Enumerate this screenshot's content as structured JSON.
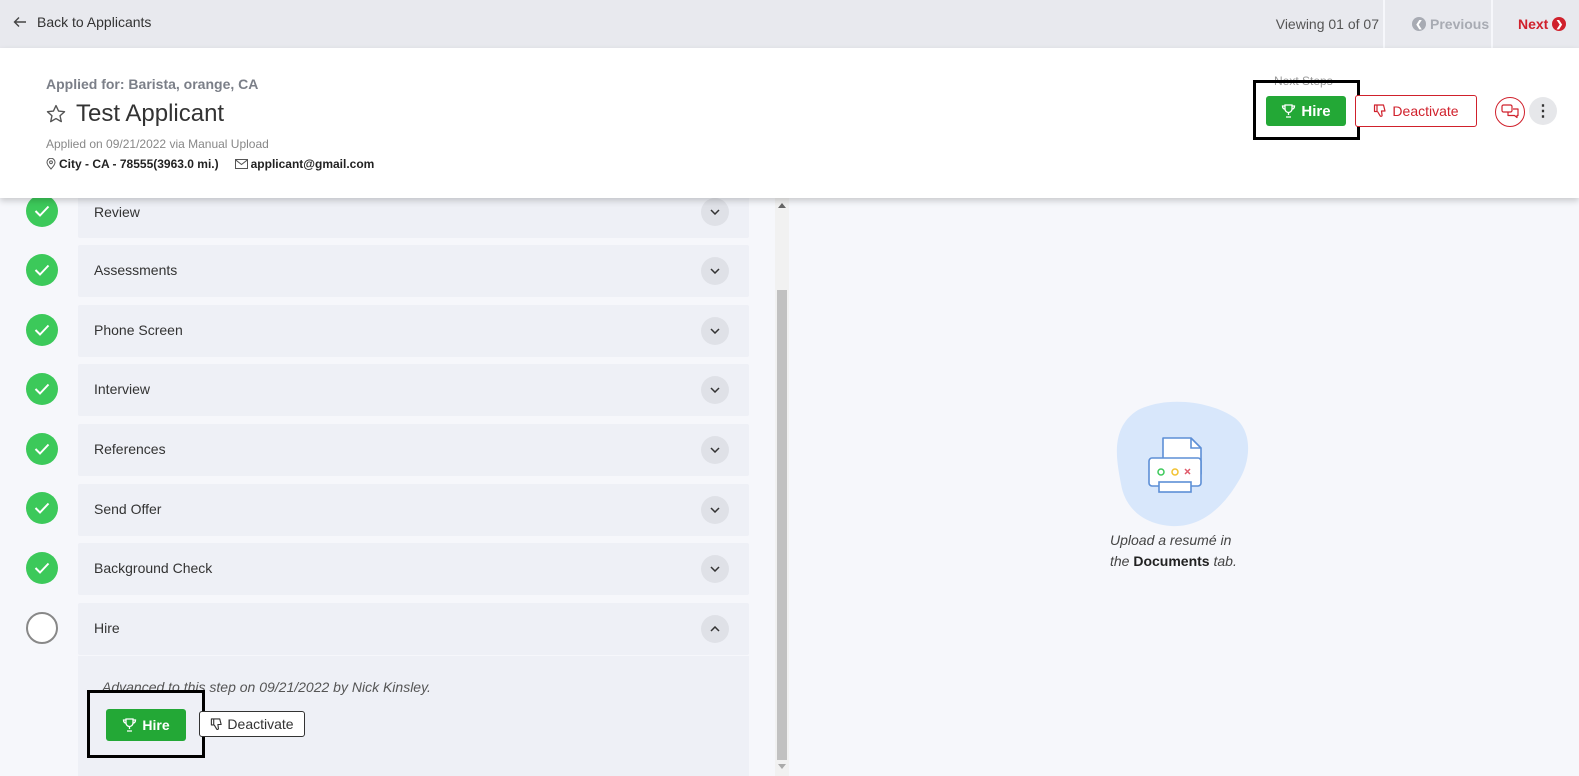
{
  "topbar": {
    "back_label": "Back to Applicants",
    "viewing": "Viewing 01 of 07",
    "previous_label": "Previous",
    "next_label": "Next"
  },
  "applicant": {
    "applied_for": "Applied for: Barista, orange, CA",
    "name": "Test Applicant",
    "applied_on": "Applied on 09/21/2022 via Manual Upload",
    "location": "City - CA - 78555(3963.0 mi.)",
    "email": "applicant@gmail.com"
  },
  "actions": {
    "next_steps_label": "Next Steps",
    "hire_label": "Hire",
    "deactivate_label": "Deactivate"
  },
  "steps": [
    {
      "label": "Review",
      "status": "complete"
    },
    {
      "label": "Assessments",
      "status": "complete"
    },
    {
      "label": "Phone Screen",
      "status": "complete"
    },
    {
      "label": "Interview",
      "status": "complete"
    },
    {
      "label": "References",
      "status": "complete"
    },
    {
      "label": "Send Offer",
      "status": "complete"
    },
    {
      "label": "Background Check",
      "status": "complete"
    },
    {
      "label": "Hire",
      "status": "current"
    }
  ],
  "hire_step": {
    "advanced_text": "Advanced to this step on 09/21/2022 by Nick Kinsley.",
    "hire_label": "Hire",
    "deactivate_label": "Deactivate"
  },
  "resume_panel": {
    "line1": "Upload a resumé in",
    "line2_prefix": "the",
    "documents_link": "Documents",
    "line2_suffix": "tab."
  },
  "colors": {
    "accent_red": "#d0212c",
    "hire_green": "#23a836",
    "check_green": "#3cc95a"
  }
}
